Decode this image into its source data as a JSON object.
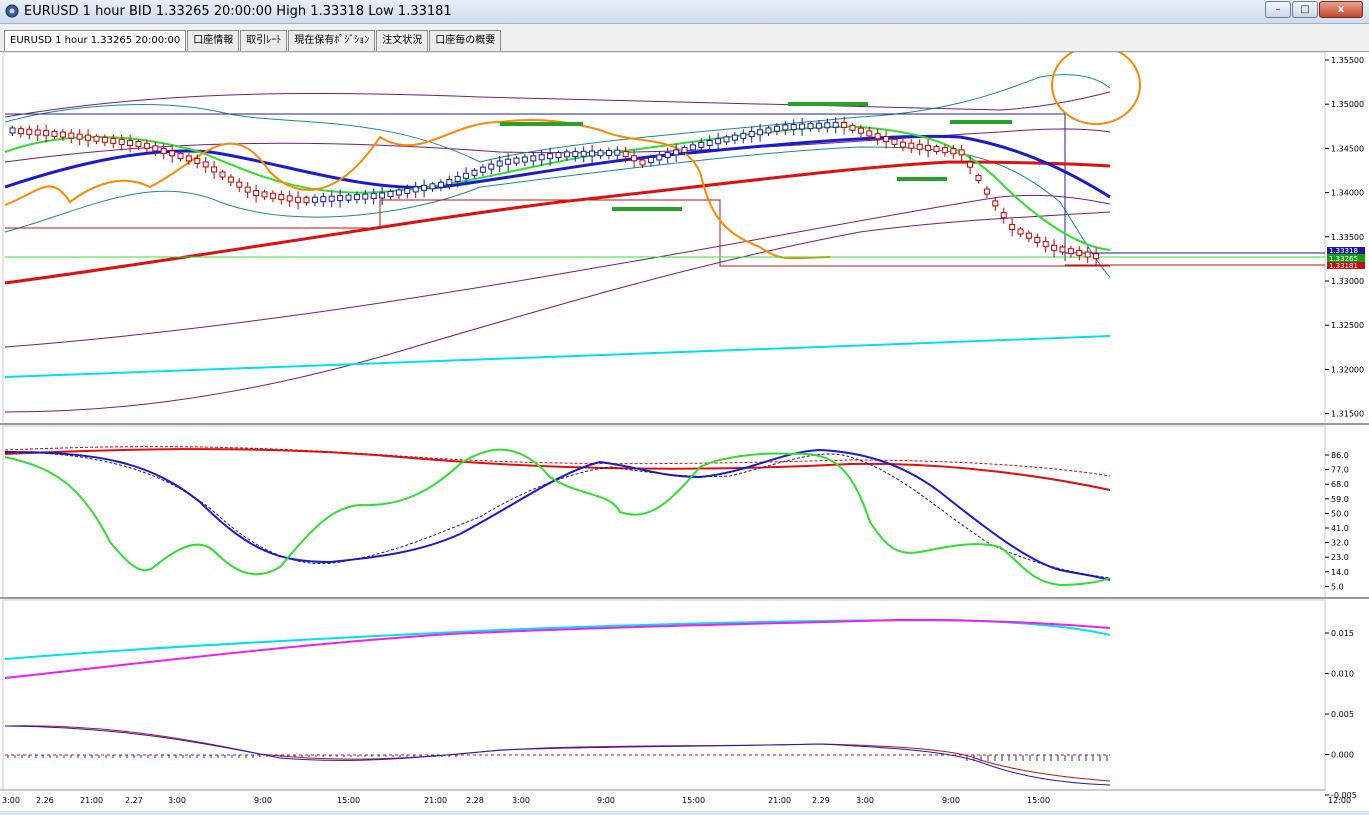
{
  "window": {
    "title": "EURUSD 1 hour BID 1.33265 20:00:00 High 1.33318 Low 1.33181",
    "minimize_glyph": "–",
    "maximize_glyph": "□",
    "close_glyph": "x"
  },
  "tabs": [
    {
      "label": "EURUSD 1 hour 1.33265 20:00:00",
      "active": true
    },
    {
      "label": "口座情報",
      "active": false
    },
    {
      "label": "取引ﾚｰﾄ",
      "active": false
    },
    {
      "label": "現在保有ﾎﾟｼﾞｼｮﾝ",
      "active": false
    },
    {
      "label": "注文状況",
      "active": false
    },
    {
      "label": "口座毎の概要",
      "active": false
    }
  ],
  "colors": {
    "accent_orange": "#ff8800",
    "marker_green": "#2aa02a",
    "candle_bull": "#1a1aa0",
    "candle_bear": "#c00000"
  },
  "price_panel": {
    "ticks": [
      "1.35500",
      "1.35000",
      "1.34500",
      "1.34000",
      "1.33500",
      "1.33000",
      "1.32500",
      "1.32000",
      "1.31500"
    ],
    "tags": {
      "high": "1.33318",
      "bid": "1.33265",
      "low": "1.33181"
    }
  },
  "stoch_panel": {
    "ticks": [
      "86.0",
      "77.0",
      "68.0",
      "59.0",
      "50.0",
      "41.0",
      "32.0",
      "23.0",
      "14.0",
      "5.0"
    ]
  },
  "macd_panel": {
    "ticks": [
      "0.015",
      "0.010",
      "0.005",
      "0.000",
      "-0.005"
    ]
  },
  "time_axis": {
    "labels": [
      "3:00",
      "2.26",
      "21:00",
      "2.27",
      "3:00",
      "9:00",
      "15:00",
      "21:00",
      "2.28",
      "3:00",
      "9:00",
      "15:00",
      "21:00",
      "2.29",
      "3:00",
      "9:00",
      "15:00"
    ],
    "last_label": "12:00"
  }
}
